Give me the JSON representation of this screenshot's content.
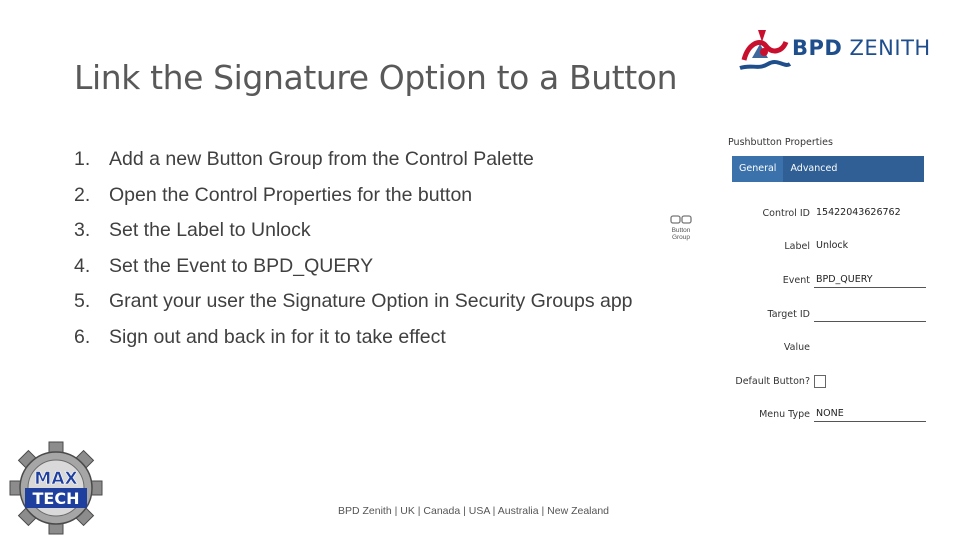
{
  "slide": {
    "title": "Link the Signature Option to a Button",
    "steps": [
      {
        "num": "1.",
        "text": "Add a new Button Group from the Control Palette"
      },
      {
        "num": "2.",
        "text": "Open the Control Properties for the button"
      },
      {
        "num": "3.",
        "text": "Set the Label to Unlock"
      },
      {
        "num": "4.",
        "text": "Set the Event to BPD_QUERY"
      },
      {
        "num": "5.",
        "text": "Grant your user the Signature Option in Security Groups app"
      },
      {
        "num": "6.",
        "text": "Sign out and back in for it to take effect"
      }
    ],
    "footer": "BPD Zenith | UK | Canada | USA | Australia | New Zealand"
  },
  "logo": {
    "word_bold": "BPD",
    "word_light": " ZENITH",
    "colors": {
      "red": "#c8102e",
      "blue": "#1f4e8c"
    }
  },
  "button_group_icon": {
    "line1": "Button",
    "line2": "Group",
    "icon": "button-group-icon"
  },
  "properties_panel": {
    "title": "Pushbutton Properties",
    "tabs": [
      {
        "label": "General"
      },
      {
        "label": "Advanced"
      }
    ],
    "fields": {
      "control_id": {
        "label": "Control ID",
        "value": "15422043626762"
      },
      "label": {
        "label": "Label",
        "value": "Unlock"
      },
      "event": {
        "label": "Event",
        "value": "BPD_QUERY"
      },
      "target_id": {
        "label": "Target ID",
        "value": ""
      },
      "value": {
        "label": "Value",
        "value": ""
      },
      "default_button": {
        "label": "Default Button?"
      },
      "menu_type": {
        "label": "Menu Type",
        "value": "NONE"
      }
    },
    "colors": {
      "tab_bar": "#2f5f95",
      "active_tab": "#3c72ab"
    }
  },
  "maxtech_logo": {
    "line1": "MAX",
    "line2": "TECH"
  }
}
